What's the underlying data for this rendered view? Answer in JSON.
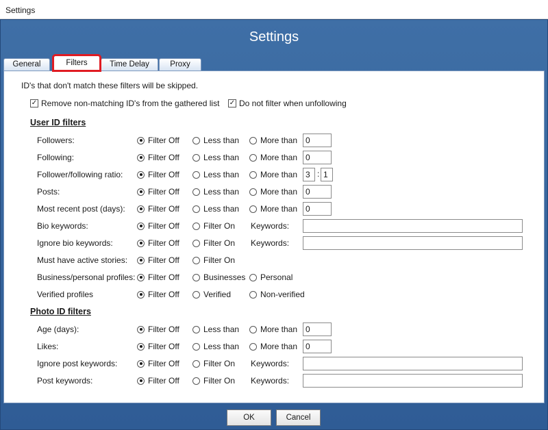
{
  "window": {
    "title": "Settings"
  },
  "header": {
    "title": "Settings"
  },
  "tabs": [
    {
      "label": "General"
    },
    {
      "label": "Filters"
    },
    {
      "label": "Time Delay"
    },
    {
      "label": "Proxy"
    }
  ],
  "active_tab": "Filters",
  "intro_text": "ID's that don't match these filters will be skipped.",
  "checks": {
    "remove_nonmatching": {
      "label": "Remove non-matching ID's from the gathered list",
      "checked": true
    },
    "no_filter_unfollow": {
      "label": "Do not filter when unfollowing",
      "checked": true
    }
  },
  "user_section": {
    "title": "User ID filters"
  },
  "photo_section": {
    "title": "Photo ID filters"
  },
  "option_labels": {
    "filter_off": "Filter Off",
    "less_than": "Less than",
    "more_than": "More than",
    "filter_on": "Filter On",
    "keywords": "Keywords:",
    "businesses": "Businesses",
    "personal": "Personal",
    "verified": "Verified",
    "non_verified": "Non-verified"
  },
  "user_rows": {
    "followers": {
      "label": "Followers:",
      "value": "0"
    },
    "following": {
      "label": "Following:",
      "value": "0"
    },
    "ratio": {
      "label": "Follower/following ratio:",
      "value_a": "3",
      "sep": ":",
      "value_b": "1"
    },
    "posts": {
      "label": "Posts:",
      "value": "0"
    },
    "recent_post": {
      "label": "Most recent post (days):",
      "value": "0"
    },
    "bio_keywords": {
      "label": "Bio keywords:",
      "value": ""
    },
    "ignore_bio": {
      "label": "Ignore bio keywords:",
      "value": ""
    },
    "stories": {
      "label": "Must have active stories:"
    },
    "business": {
      "label": "Business/personal profiles:"
    },
    "verified": {
      "label": "Verified profiles"
    }
  },
  "photo_rows": {
    "age": {
      "label": "Age (days):",
      "value": "0"
    },
    "likes": {
      "label": "Likes:",
      "value": "0"
    },
    "ignore_post": {
      "label": "Ignore post keywords:",
      "value": ""
    },
    "post_keywords": {
      "label": "Post keywords:",
      "value": ""
    }
  },
  "buttons": {
    "ok": "OK",
    "cancel": "Cancel"
  },
  "colors": {
    "frame": "#2f5c95",
    "tab_highlight": "#e01b22"
  }
}
